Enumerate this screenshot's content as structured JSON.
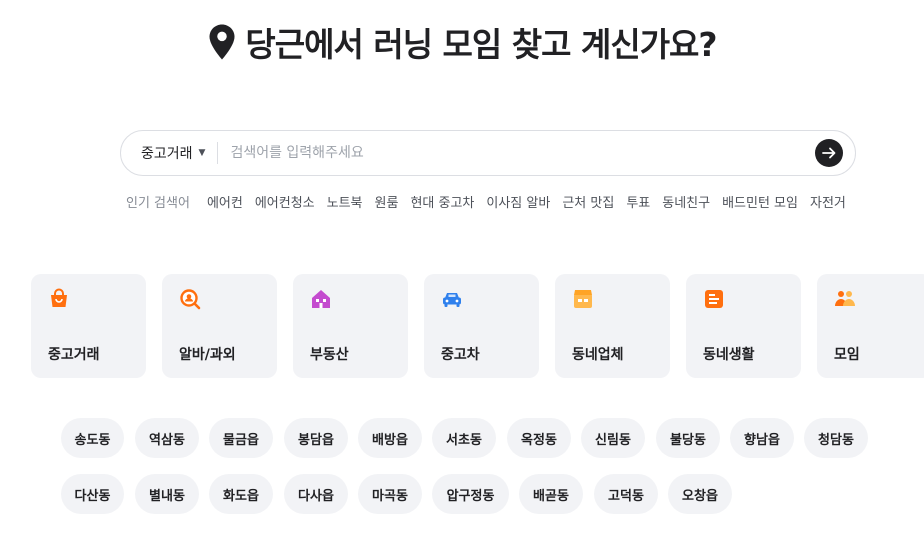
{
  "headline": {
    "text": "당근에서 러닝 모임 찾고 계신가요?"
  },
  "search": {
    "category": "중고거래",
    "placeholder": "검색어를 입력해주세요"
  },
  "popular": {
    "label": "인기 검색어",
    "keywords": [
      "에어컨",
      "에어컨청소",
      "노트북",
      "원룸",
      "현대 중고차",
      "이사짐 알바",
      "근처 맛집",
      "투표",
      "동네친구",
      "배드민턴 모임",
      "자전거"
    ]
  },
  "categories": [
    {
      "label": "중고거래",
      "icon": "shopping-bag-icon",
      "color": "#ff6f0f"
    },
    {
      "label": "알바/과외",
      "icon": "search-person-icon",
      "color": "#ff6f0f"
    },
    {
      "label": "부동산",
      "icon": "house-icon",
      "color": "#c44bcf"
    },
    {
      "label": "중고차",
      "icon": "car-icon",
      "color": "#2f80ed"
    },
    {
      "label": "동네업체",
      "icon": "store-icon",
      "color": "#ffb84d"
    },
    {
      "label": "동네생활",
      "icon": "notice-board-icon",
      "color": "#ff6f0f"
    },
    {
      "label": "모임",
      "icon": "group-icon",
      "color": "#ff6f0f"
    }
  ],
  "neighborhoods": {
    "row1": [
      "송도동",
      "역삼동",
      "물금읍",
      "봉담읍",
      "배방읍",
      "서초동",
      "옥정동",
      "신림동",
      "불당동",
      "향남읍",
      "청담동"
    ],
    "row2": [
      "다산동",
      "별내동",
      "화도읍",
      "다사읍",
      "마곡동",
      "압구정동",
      "배곧동",
      "고덕동",
      "오창읍"
    ]
  }
}
